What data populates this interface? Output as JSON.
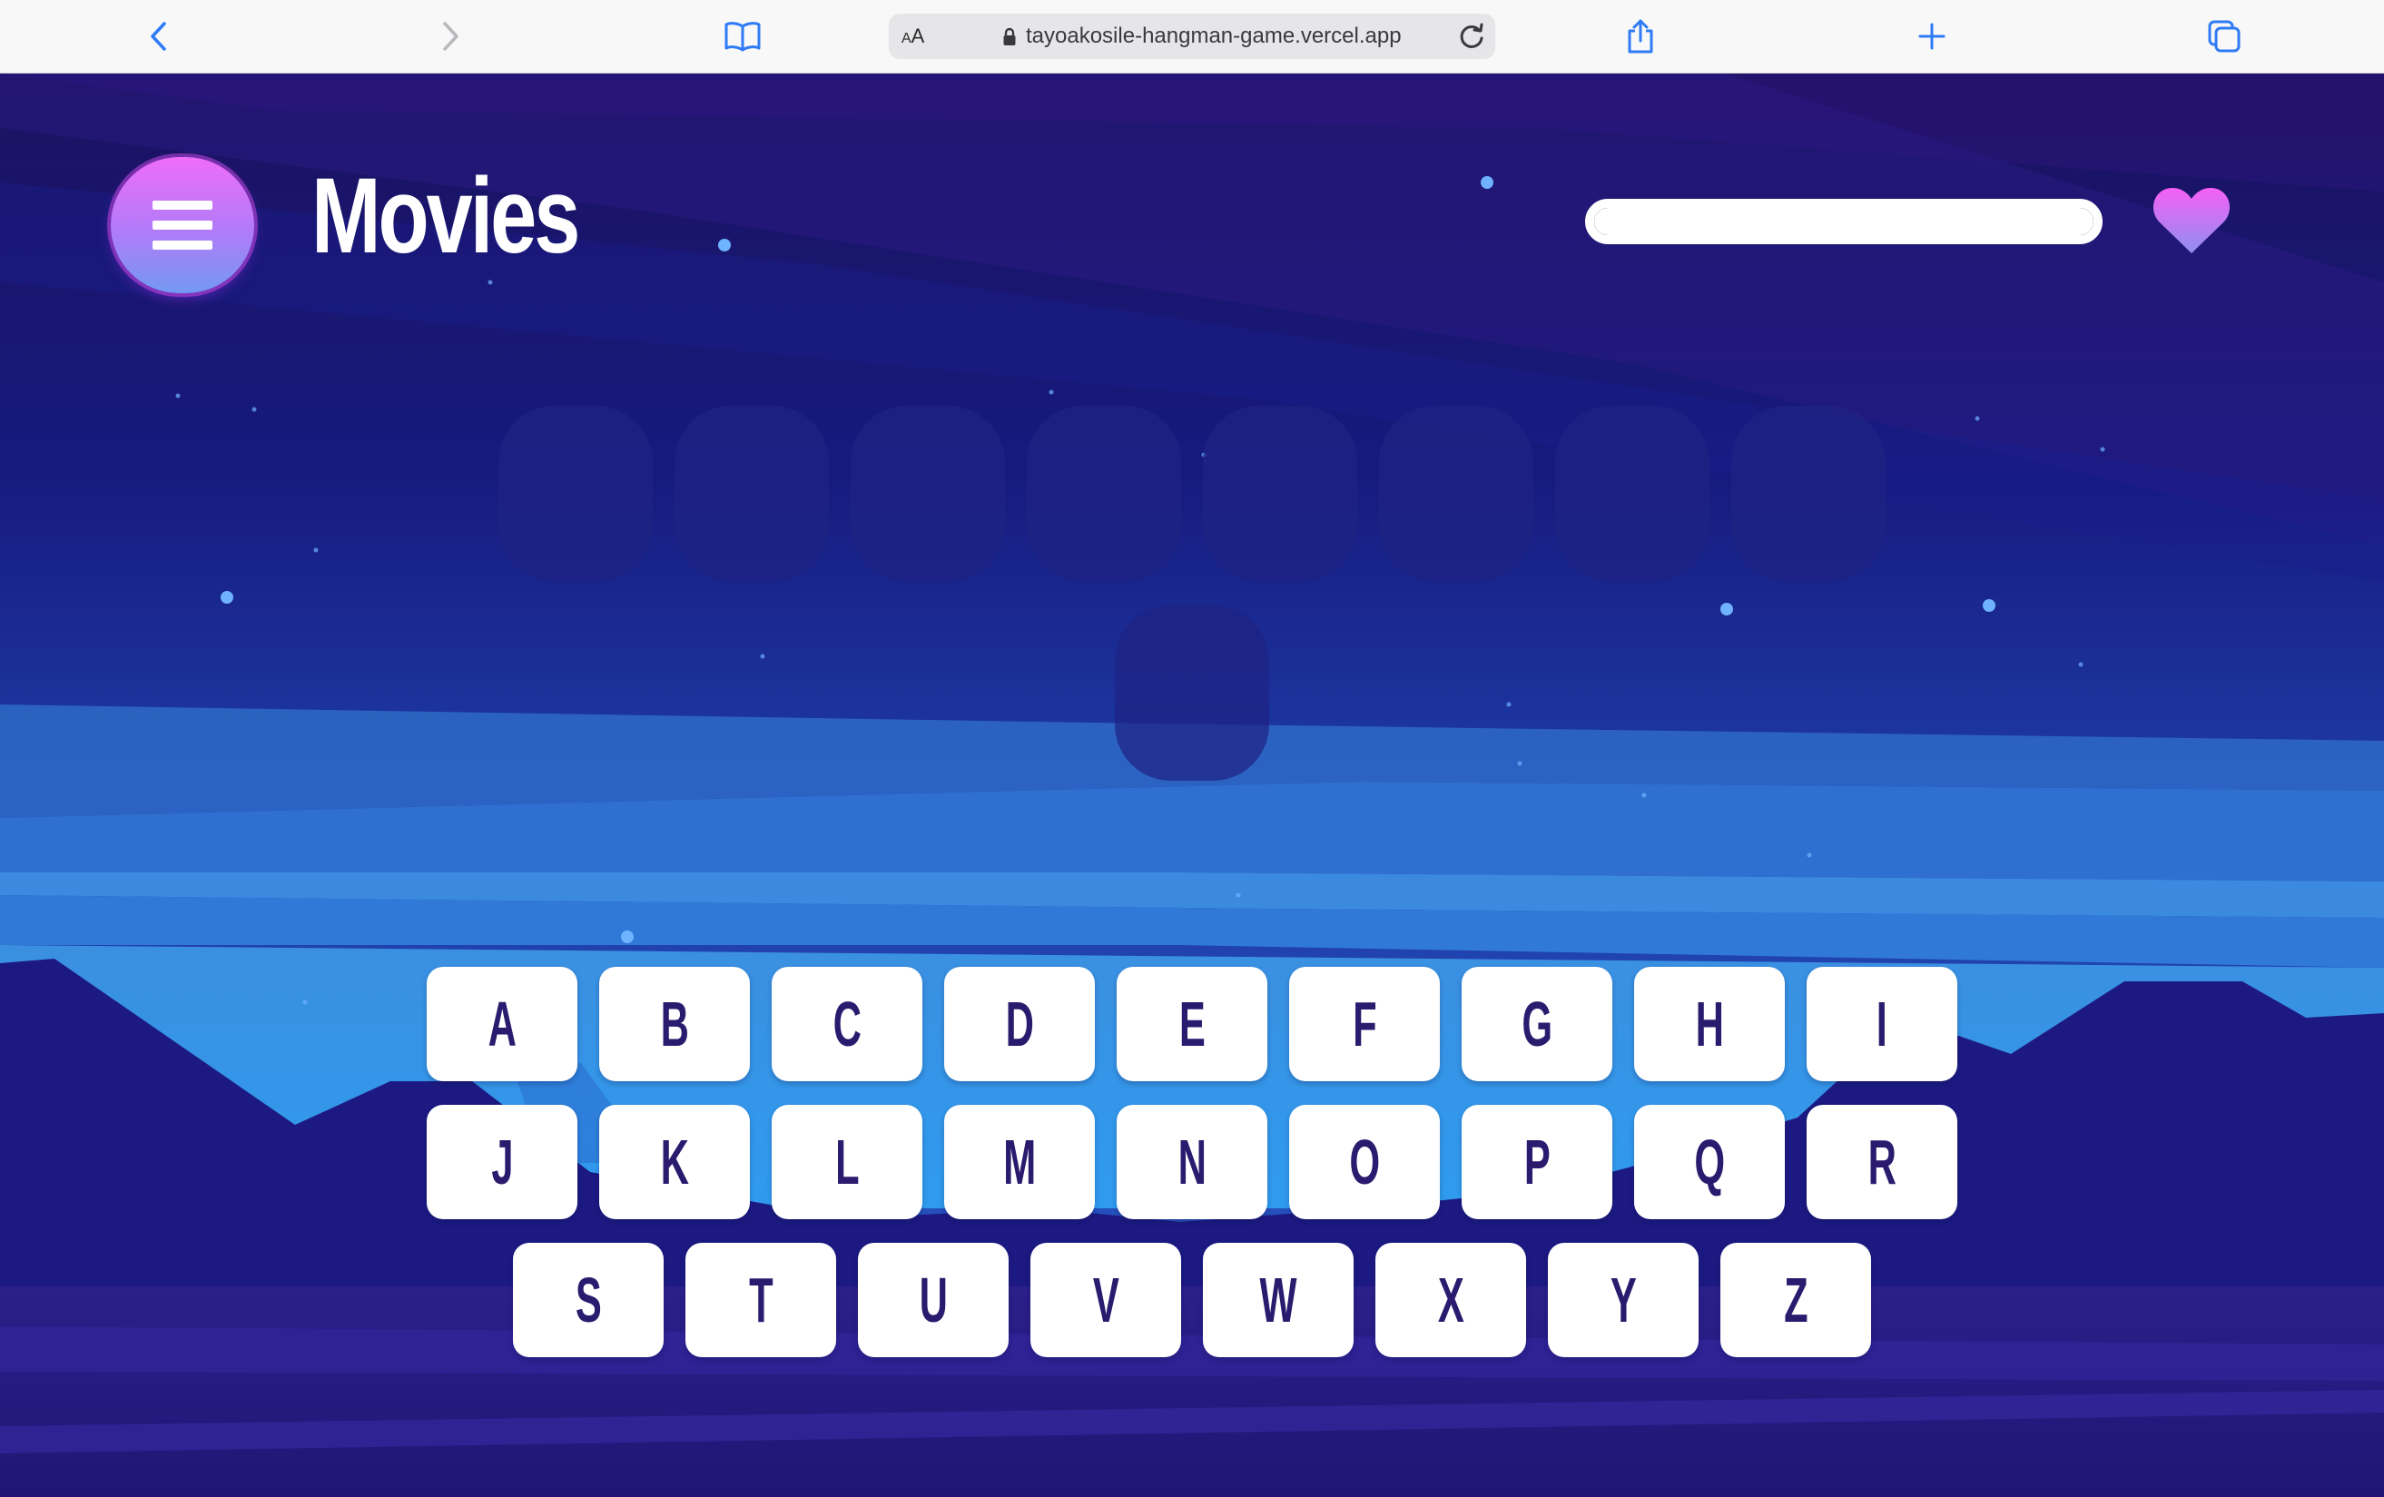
{
  "browser": {
    "aa_label_small": "A",
    "aa_label_large": "A",
    "url": "tayoakosile-hangman-game.vercel.app",
    "icons": [
      "chevron-left-icon",
      "chevron-right-icon",
      "bookmarks-icon",
      "lock-icon",
      "reload-icon",
      "share-icon",
      "plus-icon",
      "tabs-icon"
    ]
  },
  "game": {
    "category": "Movies",
    "health_fraction": 1.0,
    "icons": [
      "hamburger-menu-icon",
      "heart-icon"
    ],
    "colors": {
      "background_dark": "#1a1459",
      "keyboard_text": "#2a1b6e",
      "menu_gradient_top": "#ef6dfb",
      "menu_gradient_bottom": "#7399f2",
      "heart_top": "#f560f5",
      "heart_bottom": "#8f8ff0"
    },
    "word_rows": [
      8,
      1
    ],
    "keyboard": {
      "rows": [
        [
          "A",
          "B",
          "C",
          "D",
          "E",
          "F",
          "G",
          "H",
          "I"
        ],
        [
          "J",
          "K",
          "L",
          "M",
          "N",
          "O",
          "P",
          "Q",
          "R"
        ],
        [
          "S",
          "T",
          "U",
          "V",
          "W",
          "X",
          "Y",
          "Z"
        ]
      ]
    }
  }
}
